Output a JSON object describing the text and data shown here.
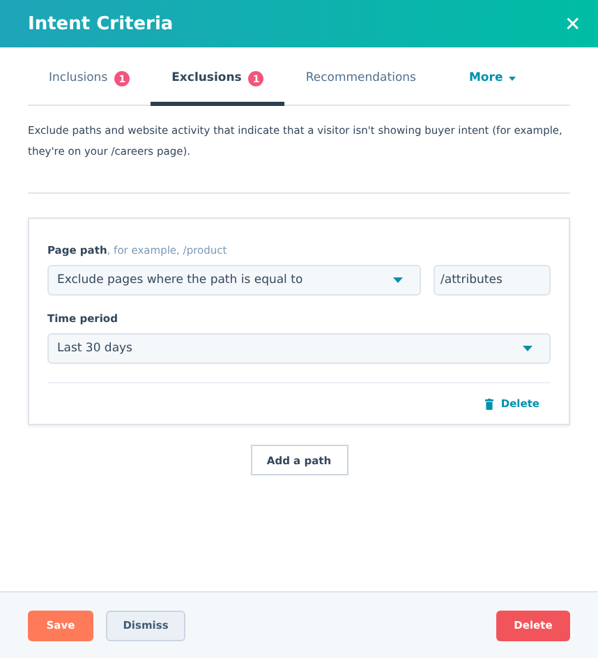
{
  "window": {
    "title": "Intent Criteria",
    "close": "✕"
  },
  "tabs": [
    {
      "label": "Inclusions",
      "badge": "1",
      "selected": false,
      "kind": "tab"
    },
    {
      "label": "Exclusions",
      "badge": "1",
      "selected": true,
      "kind": "tab"
    },
    {
      "label": "Recommendations",
      "selected": false,
      "kind": "tab"
    },
    {
      "label": "More",
      "selected": false,
      "kind": "menu"
    }
  ],
  "description": "Exclude paths and website activity that indicate that a visitor isn't showing buyer intent (for example, they're on your /careers page).",
  "rule": {
    "page_path_label": "Page path",
    "page_path_hint": ", for example, /product",
    "condition": "Exclude pages where the path is equal to",
    "path_value": "/attributes",
    "time_label": "Time period",
    "time_value": "Last 30 days",
    "delete": "Delete"
  },
  "add_button": "Add a path",
  "footer": {
    "save": "Save",
    "dismiss": "Dismiss",
    "delete": "Delete"
  }
}
